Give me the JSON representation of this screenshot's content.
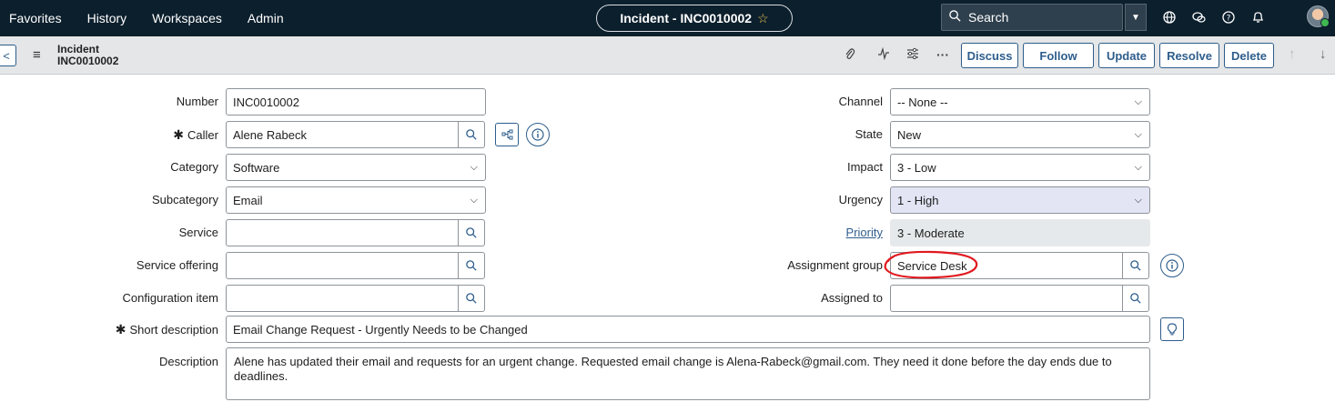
{
  "nav": {
    "links": [
      "Favorites",
      "History",
      "Workspaces",
      "Admin"
    ],
    "record_pill": "Incident - INC0010002",
    "search_label": "Search"
  },
  "header": {
    "table": "Incident",
    "number": "INC0010002",
    "buttons": {
      "discuss": "Discuss",
      "follow": "Follow",
      "update": "Update",
      "resolve": "Resolve",
      "delete": "Delete"
    }
  },
  "form": {
    "left": {
      "number": {
        "label": "Number",
        "value": "INC0010002"
      },
      "caller": {
        "label": "Caller",
        "value": "Alene Rabeck"
      },
      "category": {
        "label": "Category",
        "value": "Software"
      },
      "subcategory": {
        "label": "Subcategory",
        "value": "Email"
      },
      "service": {
        "label": "Service",
        "value": ""
      },
      "service_offering": {
        "label": "Service offering",
        "value": ""
      },
      "configuration_item": {
        "label": "Configuration item",
        "value": ""
      }
    },
    "right": {
      "channel": {
        "label": "Channel",
        "value": "-- None --"
      },
      "state": {
        "label": "State",
        "value": "New"
      },
      "impact": {
        "label": "Impact",
        "value": "3 - Low"
      },
      "urgency": {
        "label": "Urgency",
        "value": "1 - High"
      },
      "priority": {
        "label": "Priority",
        "value": "3 - Moderate"
      },
      "assignment_group": {
        "label": "Assignment group",
        "value": "Service Desk"
      },
      "assigned_to": {
        "label": "Assigned to",
        "value": ""
      }
    },
    "short_description": {
      "label": "Short description",
      "value": "Email Change Request - Urgently Needs to be Changed"
    },
    "description": {
      "label": "Description",
      "value": "Alene has updated their email and requests for an urgent change.  Requested email change is Alena-Rabeck@gmail.com. They need it done before the day ends due to deadlines."
    }
  },
  "colors": {
    "nav_bg": "#0c1f2d",
    "accent": "#2e5d8c",
    "annotation": "#e0191f"
  }
}
